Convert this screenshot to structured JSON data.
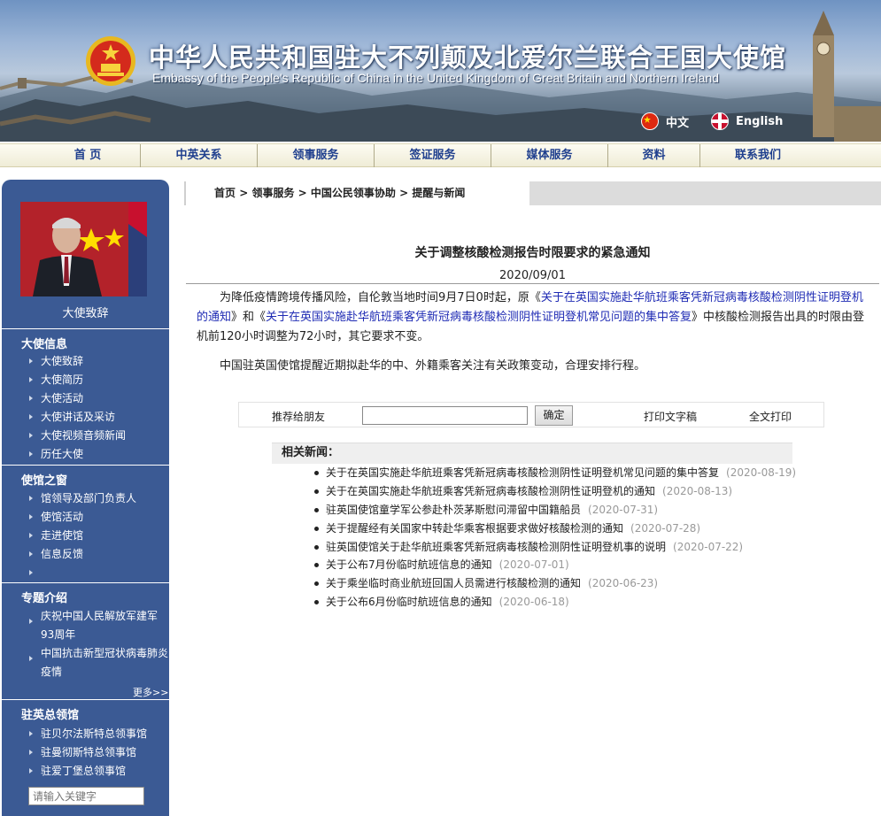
{
  "header": {
    "title_cn": "中华人民共和国驻大不列颠及北爱尔兰联合王国大使馆",
    "title_en": "Embassy of the People's Republic of China in the United Kingdom of Great Britain and Northern Ireland",
    "lang_cn": "中文",
    "lang_en": "English"
  },
  "nav": [
    {
      "label": "首  页"
    },
    {
      "label": "中英关系"
    },
    {
      "label": "领事服务"
    },
    {
      "label": "签证服务"
    },
    {
      "label": "媒体服务"
    },
    {
      "label": "资料"
    },
    {
      "label": "联系我们"
    }
  ],
  "sidebar": {
    "ambassador_label": "大使致辞",
    "sections": [
      {
        "title": "大使信息",
        "items": [
          "大使致辞",
          "大使简历",
          "大使活动",
          "大使讲话及采访",
          "大使视频音频新闻",
          "历任大使"
        ]
      },
      {
        "title": "使馆之窗",
        "items": [
          "馆领导及部门负责人",
          "使馆活动",
          "走进使馆",
          "信息反馈",
          ""
        ]
      },
      {
        "title": "专题介绍",
        "items": [
          "庆祝中国人民解放军建军93周年",
          "中国抗击新型冠状病毒肺炎疫情"
        ]
      },
      {
        "title": "驻英总领馆",
        "items": [
          "驻贝尔法斯特总领事馆",
          "驻曼彻斯特总领事馆",
          "驻爱丁堡总领事馆"
        ]
      }
    ],
    "more": "更多>>",
    "search_placeholder": "请输入关键字"
  },
  "breadcrumb": [
    "首页",
    "领事服务",
    "中国公民领事协助",
    "提醒与新闻"
  ],
  "article": {
    "title": "关于调整核酸检测报告时限要求的紧急通知",
    "date": "2020/09/01",
    "p1_a": "为降低疫情跨境传播风险，自伦敦当地时间9月7日0时起，原《",
    "p1_link1": "关于在英国实施赴华航班乘客凭新冠病毒核酸检测阴性证明登机的通知",
    "p1_b": "》和《",
    "p1_link2": "关于在英国实施赴华航班乘客凭新冠病毒核酸检测阴性证明登机常见问题的集中答复",
    "p1_c": "》中核酸检测报告出具的时限由登机前120小时调整为72小时，其它要求不变。",
    "p2": "中国驻英国使馆提醒近期拟赴华的中、外籍乘客关注有关政策变动，合理安排行程。"
  },
  "share": {
    "label": "推荐给朋友",
    "button": "确定",
    "print_text": "打印文字稿",
    "print_full": "全文打印"
  },
  "related": {
    "heading": "相关新闻：",
    "items": [
      {
        "title": "关于在英国实施赴华航班乘客凭新冠病毒核酸检测阴性证明登机常见问题的集中答复",
        "date": "(2020-08-19)"
      },
      {
        "title": "关于在英国实施赴华航班乘客凭新冠病毒核酸检测阴性证明登机的通知",
        "date": "(2020-08-13)"
      },
      {
        "title": "驻英国使馆童学军公参赴朴茨茅斯慰问滞留中国籍船员",
        "date": "(2020-07-31)"
      },
      {
        "title": "关于提醒经有关国家中转赴华乘客根据要求做好核酸检测的通知",
        "date": "(2020-07-28)"
      },
      {
        "title": "驻英国使馆关于赴华航班乘客凭新冠病毒核酸检测阴性证明登机事的说明",
        "date": "(2020-07-22)"
      },
      {
        "title": "关于公布7月份临时航班信息的通知",
        "date": "(2020-07-01)"
      },
      {
        "title": "关于乘坐临时商业航班回国人员需进行核酸检测的通知",
        "date": "(2020-06-23)"
      },
      {
        "title": "关于公布6月份临时航班信息的通知",
        "date": "(2020-06-18)"
      }
    ]
  }
}
